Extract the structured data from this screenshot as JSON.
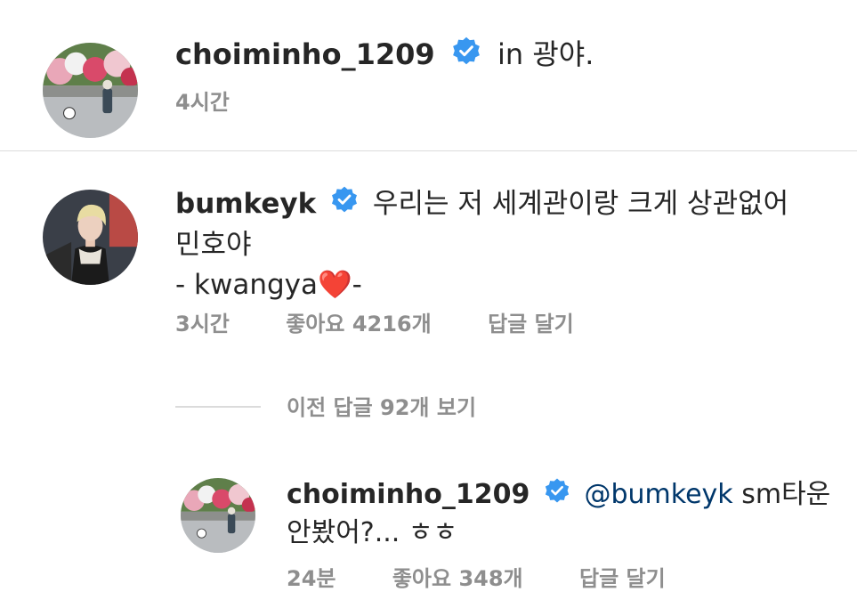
{
  "post": {
    "username": "choiminho_1209",
    "location_prefix": "in",
    "location": "광야.",
    "time": "4시간"
  },
  "comment": {
    "username": "bumkeyk",
    "text_line1": "우리는 저 세계관이랑 크게 상관없어",
    "text_line2": "민호야",
    "text_line3": "- kwangya❤️-",
    "time": "3시간",
    "likes": "좋아요 4216개",
    "reply_label": "답글 달기"
  },
  "view_replies": "이전 답글 92개 보기",
  "reply": {
    "username": "choiminho_1209",
    "mention": "@bumkeyk",
    "text_part1": "sm타운",
    "text_line2": "안봤어?... ㅎㅎ",
    "time": "24분",
    "likes": "좋아요 348개",
    "reply_label": "답글 달기"
  },
  "colors": {
    "verified": "#3897f0",
    "muted": "#8e8e8e",
    "mention": "#00376b",
    "divider": "#dbdbdb"
  }
}
